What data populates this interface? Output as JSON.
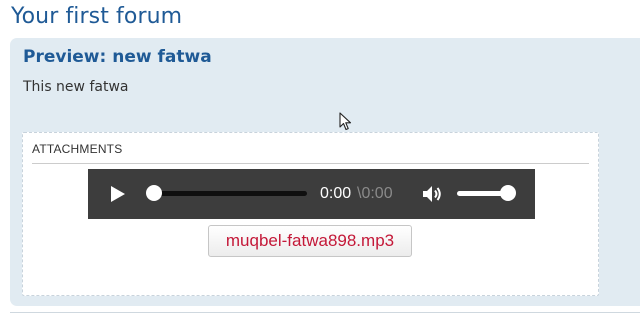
{
  "forum": {
    "title": "Your first forum"
  },
  "preview": {
    "heading": "Preview: new fatwa",
    "content": "This new fatwa"
  },
  "attachments": {
    "heading": "ATTACHMENTS",
    "player": {
      "current_time": "0:00",
      "duration_display": "\\0:00",
      "progress": 0,
      "volume": 1
    },
    "file_name": "muqbel-fatwa898.mp3"
  },
  "colors": {
    "title": "#1f5a96",
    "panel_bg": "#e1ebf2",
    "player_bg": "#3d3d3d",
    "file_link": "#c41838"
  },
  "icons": {
    "play": "play-icon",
    "volume": "speaker-icon",
    "cursor": "mouse-pointer-icon"
  }
}
